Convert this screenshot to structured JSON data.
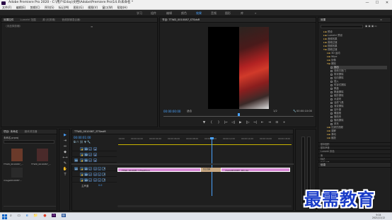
{
  "titlebar": {
    "title": "Adobe Premiere Pro 2020 - C:\\用户\\Eday\\文档\\Adobe\\Premiere Pro\\14.0\\未命名 *",
    "minimize": "—",
    "maximize": "☐",
    "close": "✕"
  },
  "menubar": {
    "items": [
      "文件(F)",
      "编辑(E)",
      "剪辑(C)",
      "序列(S)",
      "标记(M)",
      "图形(G)",
      "视图(V)",
      "窗口(W)",
      "帮助(H)"
    ]
  },
  "workspaces": {
    "items": [
      "学习",
      "组件",
      "编辑",
      "颜色",
      "效果",
      "音频",
      "图形",
      "库"
    ],
    "active_index": 4,
    "more": "»"
  },
  "source_panel": {
    "tabs": [
      "效果控件",
      "Lumetri 范围",
      "源:(无剪辑)",
      "音频剪辑混合器:"
    ],
    "active_tab_index": 0,
    "no_clip_text": "（未选择剪辑）",
    "menu_icon": "≡"
  },
  "program_monitor": {
    "tab": "节目: TTWD_0010087_STSdsR",
    "timecode_left": "00:00:00:00",
    "fit_label": "适合",
    "ratio": "1/2",
    "timecode_right": "00:00:10:00",
    "controls": [
      "▼",
      "{",
      "}",
      "|←",
      "◁|",
      "▶",
      "|▷",
      "→|",
      "⇤",
      "⇥",
      "⊡",
      "+"
    ]
  },
  "project_panel": {
    "tabs": [
      "项目: 未命名",
      "媒体浏览器"
    ],
    "project_file": "未命名.prproj",
    "search_placeholder": "",
    "items": [
      {
        "name": "TTWD_0010087_...",
        "duration": "5;00",
        "color": "#6a3a2a"
      },
      {
        "name": "TTWD_0010087_...",
        "duration": "5;00",
        "color": "#4a2a2a"
      },
      {
        "name": "image0010087...",
        "duration": "5;00",
        "color": "#2a2a2a"
      }
    ]
  },
  "tools": {
    "items": [
      "▶",
      "⇥",
      "⇔",
      "◆",
      "⟷",
      "✎",
      "✋",
      "T"
    ]
  },
  "timeline": {
    "tab": "TTWD_0010087_STSeaM",
    "timecode": "00:00:01:00",
    "ruler_labels": [
      ":00:00",
      "00:00:02:00",
      "00:00:04:00",
      "00:00:06:00",
      "00:00:08:00",
      "00:00:10:00",
      "00:00:12:00",
      "00:00:14:00",
      "00:00:16:00",
      "00:00:18:00"
    ],
    "video_tracks": [
      {
        "label": "V3",
        "toggle": "V3"
      },
      {
        "label": "V2",
        "toggle": "V2"
      },
      {
        "label": "V1",
        "toggle": "V1"
      }
    ],
    "audio_tracks": [
      {
        "label": "A1",
        "toggle": "A1"
      },
      {
        "label": "A2",
        "toggle": "A2"
      },
      {
        "label": "A3",
        "toggle": "A3"
      }
    ],
    "master_label": "主声道",
    "master_value": "0.0",
    "clips": [
      {
        "label": "TTWD_0010087_STSeaM.jpg",
        "color": "#d98ad6"
      },
      {
        "label": "交叉溶解",
        "color": "#c8a882"
      },
      {
        "label": "image0010087_001.jpg",
        "color": "#d98ad6"
      }
    ]
  },
  "effects_panel": {
    "title": "效果",
    "menu_icon": "≡",
    "search_placeholder": "",
    "tree": [
      {
        "label": "预设",
        "indent": 1,
        "type": "folder"
      },
      {
        "label": "Lumetri 预设",
        "indent": 1,
        "type": "folder"
      },
      {
        "label": "音频效果",
        "indent": 1,
        "type": "folder"
      },
      {
        "label": "音频过渡",
        "indent": 1,
        "type": "folder"
      },
      {
        "label": "视频效果",
        "indent": 1,
        "type": "folder"
      },
      {
        "label": "视频过渡",
        "indent": 1,
        "type": "folder-open"
      },
      {
        "label": "3D 运动",
        "indent": 2,
        "type": "folder"
      },
      {
        "label": "Wipe",
        "indent": 2,
        "type": "folder"
      },
      {
        "label": "划像",
        "indent": 2,
        "type": "folder"
      },
      {
        "label": "擦除",
        "indent": 2,
        "type": "folder-open"
      },
      {
        "label": "划出",
        "indent": 3,
        "type": "item",
        "selected": true
      },
      {
        "label": "双侧平推门",
        "indent": 3,
        "type": "item"
      },
      {
        "label": "带状擦除",
        "indent": 3,
        "type": "item"
      },
      {
        "label": "径向擦除",
        "indent": 3,
        "type": "item"
      },
      {
        "label": "插入",
        "indent": 3,
        "type": "item"
      },
      {
        "label": "时钟式擦除",
        "indent": 3,
        "type": "item"
      },
      {
        "label": "棋盘",
        "indent": 3,
        "type": "item"
      },
      {
        "label": "棋盘擦除",
        "indent": 3,
        "type": "item"
      },
      {
        "label": "楔形擦除",
        "indent": 3,
        "type": "item"
      },
      {
        "label": "水波块",
        "indent": 3,
        "type": "item"
      },
      {
        "label": "油漆飞溅",
        "indent": 3,
        "type": "item"
      },
      {
        "label": "渐变擦除",
        "indent": 3,
        "type": "item"
      },
      {
        "label": "百叶窗",
        "indent": 3,
        "type": "item"
      },
      {
        "label": "螺旋框",
        "indent": 3,
        "type": "item"
      },
      {
        "label": "随机块",
        "indent": 3,
        "type": "item"
      },
      {
        "label": "随机擦除",
        "indent": 3,
        "type": "item"
      },
      {
        "label": "风车",
        "indent": 3,
        "type": "item"
      },
      {
        "label": "沉浸式视频",
        "indent": 2,
        "type": "folder"
      },
      {
        "label": "溶解",
        "indent": 2,
        "type": "folder"
      },
      {
        "label": "滑动",
        "indent": 2,
        "type": "folder"
      },
      {
        "label": "缩放",
        "indent": 2,
        "type": "folder"
      }
    ],
    "bottom_panels": [
      "基本图形",
      "基本声音",
      "Lumetri 颜色",
      "库",
      "标记",
      "历史记录",
      "信息"
    ]
  },
  "watermark": {
    "text": "最需教育"
  },
  "taskbar": {
    "start_icon": "windows-icon",
    "apps": [
      "⌕",
      "▭",
      "e",
      "📁",
      "●",
      "Pr",
      "W"
    ],
    "time": "9:04",
    "date": "2021/11/12"
  }
}
